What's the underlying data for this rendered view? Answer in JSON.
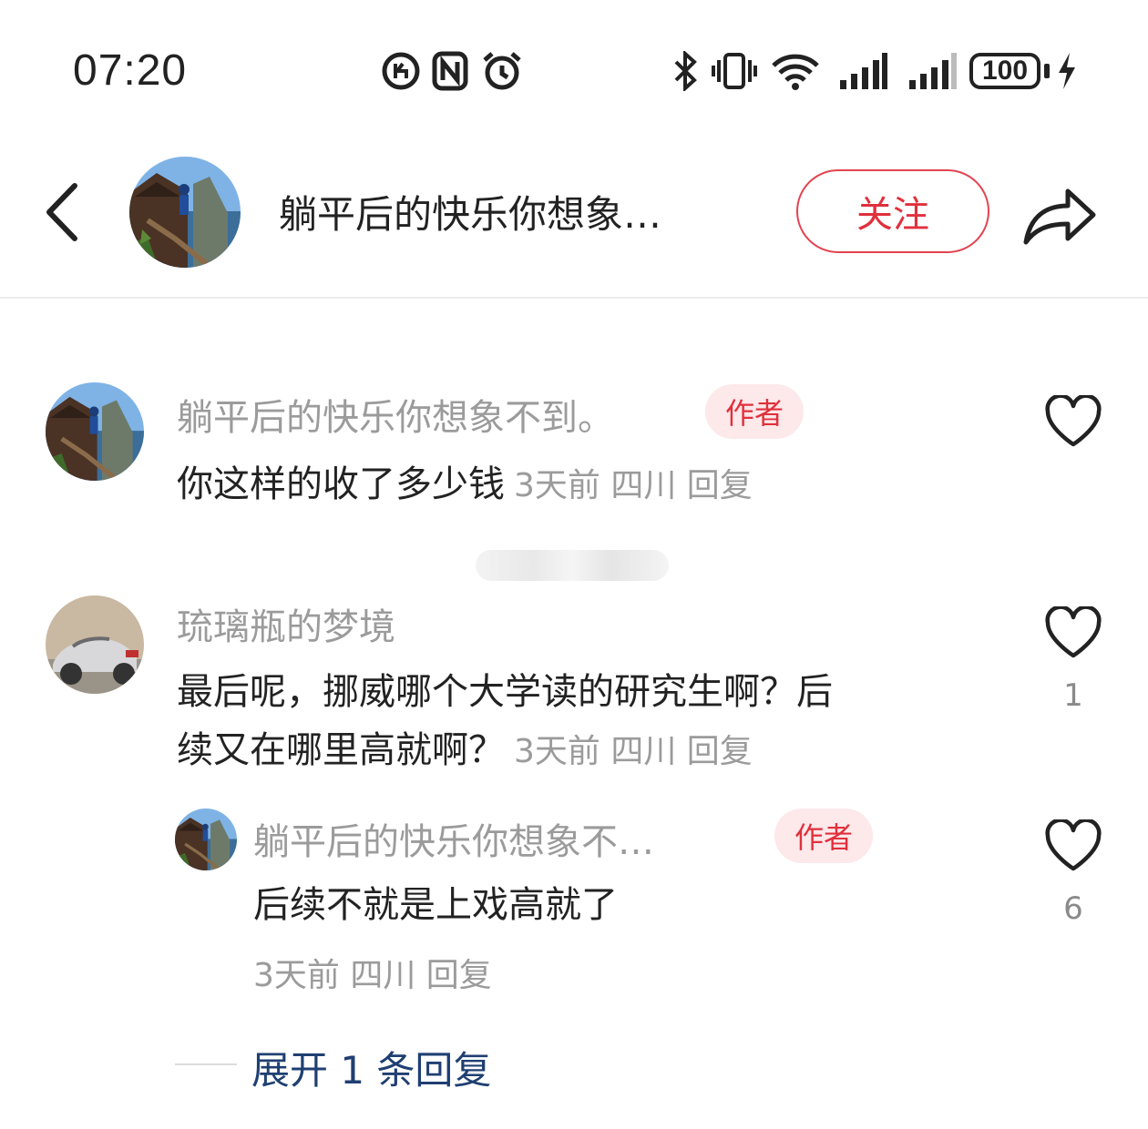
{
  "status_bar": {
    "time": "07:20",
    "battery": "100",
    "icons": [
      "data-saver-icon",
      "nfc-icon",
      "alarm-icon",
      "bluetooth-icon",
      "vibrate-icon",
      "wifi-icon",
      "signal-icon",
      "signal-icon",
      "charging-icon"
    ]
  },
  "header": {
    "title": "躺平后的快乐你想象…",
    "follow_label": "关注"
  },
  "comments": [
    {
      "author": "躺平后的快乐你想象不到。",
      "badge": "作者",
      "text": "你这样的收了多少钱",
      "meta": "3天前 四川 回复",
      "likes": ""
    },
    {
      "author": "琉璃瓶的梦境",
      "text_line1": "最后呢，挪威哪个大学读的研究生啊？后",
      "text_line2": "续又在哪里高就啊？",
      "meta": "3天前 四川 回复",
      "likes": "1",
      "replies": [
        {
          "author": "躺平后的快乐你想象不…",
          "badge": "作者",
          "text": "后续不就是上戏高就了",
          "meta": "3天前 四川 回复",
          "likes": "6"
        }
      ],
      "expand_label": "展开 1 条回复"
    }
  ],
  "colors": {
    "accent": "#e0303c",
    "link": "#1f3f72",
    "muted": "#9b9b9b"
  }
}
